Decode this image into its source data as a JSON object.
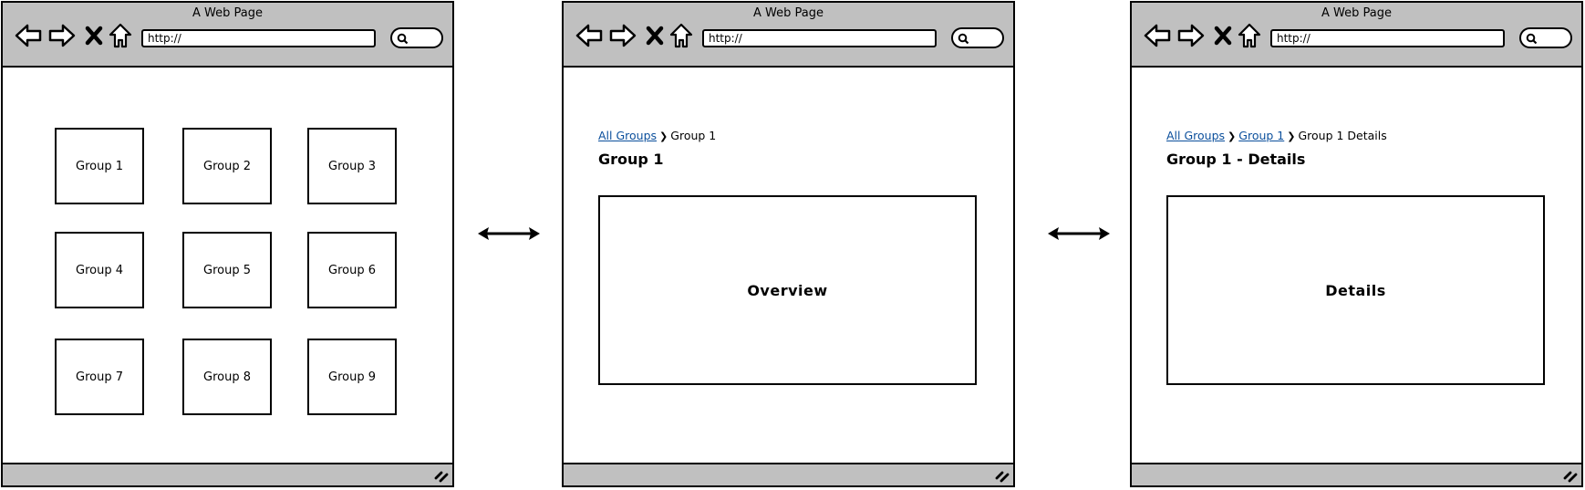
{
  "browser": {
    "title": "A Web Page",
    "url": "http://",
    "icons": [
      "back-arrow-icon",
      "forward-arrow-icon",
      "stop-icon",
      "home-icon",
      "search-icon",
      "resize-grip-icon"
    ]
  },
  "screens": [
    {
      "name": "All Groups",
      "tiles": [
        "Group 1",
        "Group 2",
        "Group 3",
        "Group 4",
        "Group 5",
        "Group 6",
        "Group 7",
        "Group 8",
        "Group 9"
      ]
    },
    {
      "name": "Group",
      "breadcrumb": [
        {
          "label": "All Groups",
          "link": true
        },
        {
          "label": "Group 1",
          "link": false
        }
      ],
      "title": "Group 1",
      "panel_label": "Overview"
    },
    {
      "name": "Group Details",
      "breadcrumb": [
        {
          "label": "All Groups",
          "link": true
        },
        {
          "label": "Group 1",
          "link": true
        },
        {
          "label": "Group 1 Details",
          "link": false
        }
      ],
      "title": "Group 1 - Details",
      "panel_label": "Details"
    }
  ],
  "connectors": [
    "bidirectional-arrow",
    "bidirectional-arrow"
  ],
  "colors": {
    "chrome": "#c0c0c0",
    "link": "#0b4f9c",
    "stroke": "#000000"
  }
}
